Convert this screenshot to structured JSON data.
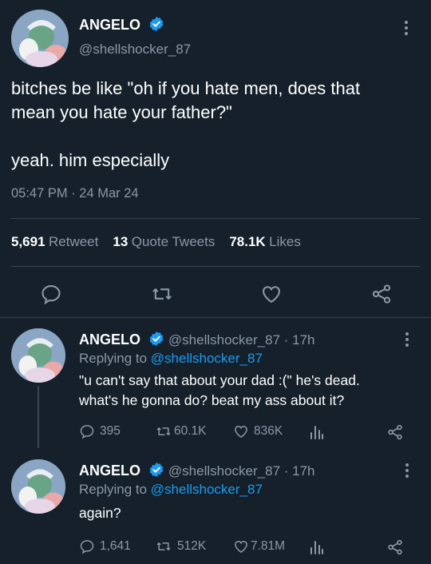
{
  "main_tweet": {
    "author_name": "ANGELO",
    "handle": "@shellshocker_87",
    "text_line1": "bitches be like \"oh if you hate men, does that",
    "text_line2": "mean you hate your father?\"",
    "text_line3": "yeah. him especially",
    "time": "05:47 PM · 24 Mar 24",
    "retweets_count": "5,691",
    "retweets_label": "Retweet",
    "quotes_count": "13",
    "quotes_label": "Quote Tweets",
    "likes_count": "78.1K",
    "likes_label": "Likes"
  },
  "replies": [
    {
      "author_name": "ANGELO",
      "handle_time": "@shellshocker_87 · 17h",
      "replying_prefix": "Replying to",
      "replying_to": "@shellshocker_87",
      "text_line1": "\"u can't say that about your dad :(\" he's dead.",
      "text_line2": "what's he gonna do? beat my ass about it?",
      "replies": "395",
      "retweets": "60.1K",
      "likes": "836K"
    },
    {
      "author_name": "ANGELO",
      "handle_time": "@shellshocker_87 · 17h",
      "replying_prefix": "Replying to",
      "replying_to": "@shellshocker_87",
      "text_line1": "again?",
      "replies": "1,641",
      "retweets": "512K",
      "likes": "7.81M"
    }
  ],
  "colors": {
    "background": "#15202b",
    "accent": "#1d9bf0",
    "muted": "#8b98a5",
    "divider": "#38444d"
  },
  "icons": [
    "verified-badge-icon",
    "more-icon",
    "reply-icon",
    "retweet-icon",
    "like-icon",
    "share-icon",
    "analytics-icon"
  ]
}
